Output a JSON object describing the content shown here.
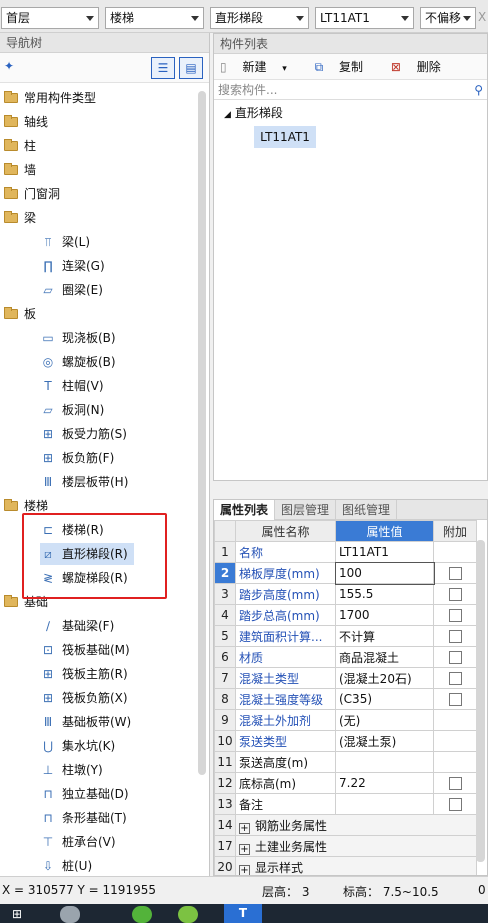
{
  "toolbar": {
    "floor": "首层",
    "type": "楼梯",
    "subtype": "直形梯段",
    "component": "LT11AT1",
    "offset": "不偏移",
    "close_glyph": "X"
  },
  "nav": {
    "title": "导航树",
    "add_glyph": "✦",
    "categories": [
      {
        "label": "常用构件类型"
      },
      {
        "label": "轴线"
      },
      {
        "label": "柱"
      },
      {
        "label": "墙"
      },
      {
        "label": "门窗洞"
      },
      {
        "label": "梁"
      },
      {
        "label": "板"
      },
      {
        "label": "楼梯"
      },
      {
        "label": "基础"
      }
    ],
    "items": [
      {
        "label": "梁(L)",
        "icon": "beam-icon",
        "glyph": "⫪"
      },
      {
        "label": "连梁(G)",
        "icon": "link-beam-icon",
        "glyph": "∏"
      },
      {
        "label": "圈梁(E)",
        "icon": "ring-beam-icon",
        "glyph": "▱"
      },
      {
        "label": "现浇板(B)",
        "icon": "slab-icon",
        "glyph": "▭"
      },
      {
        "label": "螺旋板(B)",
        "icon": "spiral-slab-icon",
        "glyph": "◎"
      },
      {
        "label": "柱帽(V)",
        "icon": "column-cap-icon",
        "glyph": "T"
      },
      {
        "label": "板洞(N)",
        "icon": "slab-hole-icon",
        "glyph": "▱"
      },
      {
        "label": "板受力筋(S)",
        "icon": "slab-rebar-icon",
        "glyph": "⊞"
      },
      {
        "label": "板负筋(F)",
        "icon": "negative-rebar-icon",
        "glyph": "⊞"
      },
      {
        "label": "楼层板带(H)",
        "icon": "slab-strip-icon",
        "glyph": "Ⅲ"
      },
      {
        "label": "楼梯(R)",
        "icon": "stair-icon",
        "glyph": "⊏"
      },
      {
        "label": "直形梯段(R)",
        "icon": "straight-flight-icon",
        "glyph": "⧄"
      },
      {
        "label": "螺旋梯段(R)",
        "icon": "spiral-flight-icon",
        "glyph": "≷"
      },
      {
        "label": "基础梁(F)",
        "icon": "foundation-beam-icon",
        "glyph": "∕"
      },
      {
        "label": "筏板基础(M)",
        "icon": "raft-foundation-icon",
        "glyph": "⊡"
      },
      {
        "label": "筏板主筋(R)",
        "icon": "raft-main-rebar-icon",
        "glyph": "⊞"
      },
      {
        "label": "筏板负筋(X)",
        "icon": "raft-negative-rebar-icon",
        "glyph": "⊞"
      },
      {
        "label": "基础板带(W)",
        "icon": "foundation-strip-icon",
        "glyph": "Ⅲ"
      },
      {
        "label": "集水坑(K)",
        "icon": "sump-pit-icon",
        "glyph": "⋃"
      },
      {
        "label": "柱墩(Y)",
        "icon": "column-pier-icon",
        "glyph": "⊥"
      },
      {
        "label": "独立基础(D)",
        "icon": "isolated-foundation-icon",
        "glyph": "⊓"
      },
      {
        "label": "条形基础(T)",
        "icon": "strip-foundation-icon",
        "glyph": "⊓"
      },
      {
        "label": "桩承台(V)",
        "icon": "pile-cap-icon",
        "glyph": "⊤"
      },
      {
        "label": "桩(U)",
        "icon": "pile-icon",
        "glyph": "⇩"
      }
    ]
  },
  "components": {
    "title": "构件列表",
    "new_label": "新建",
    "copy_label": "复制",
    "delete_label": "删除",
    "search_placeholder": "搜索构件...",
    "tree_parent": "直形梯段",
    "tree_child": "LT11AT1"
  },
  "props": {
    "tabs": [
      "属性列表",
      "图层管理",
      "图纸管理"
    ],
    "col_name": "属性名称",
    "col_value": "属性值",
    "col_extra": "附加",
    "rows": [
      {
        "no": "1",
        "name": "名称",
        "value": "LT11AT1"
      },
      {
        "no": "2",
        "name": "梯板厚度(mm)",
        "value": "100"
      },
      {
        "no": "3",
        "name": "踏步高度(mm)",
        "value": "155.5"
      },
      {
        "no": "4",
        "name": "踏步总高(mm)",
        "value": "1700"
      },
      {
        "no": "5",
        "name": "建筑面积计算...",
        "value": "不计算"
      },
      {
        "no": "6",
        "name": "材质",
        "value": "商品混凝土"
      },
      {
        "no": "7",
        "name": "混凝土类型",
        "value": "(混凝土20石)"
      },
      {
        "no": "8",
        "name": "混凝土强度等级",
        "value": "(C35)"
      },
      {
        "no": "9",
        "name": "混凝土外加剂",
        "value": "(无)"
      },
      {
        "no": "10",
        "name": "泵送类型",
        "value": "(混凝土泵)"
      },
      {
        "no": "11",
        "name": "泵送高度(m)",
        "value": ""
      },
      {
        "no": "12",
        "name": "底标高(m)",
        "value": "7.22"
      },
      {
        "no": "13",
        "name": "备注",
        "value": ""
      },
      {
        "no": "14",
        "name": "钢筋业务属性",
        "value": ""
      },
      {
        "no": "17",
        "name": "土建业务属性",
        "value": ""
      },
      {
        "no": "20",
        "name": "显示样式",
        "value": ""
      }
    ]
  },
  "status": {
    "coords": "X = 310577 Y = 1191955",
    "floor_height": "层高：  3",
    "elevation": "标高：  7.5~10.5",
    "zero": "0"
  },
  "colors": {
    "accent": "#3a7bd5",
    "selection": "#cfe0f6",
    "highlight_box": "#e02020"
  }
}
